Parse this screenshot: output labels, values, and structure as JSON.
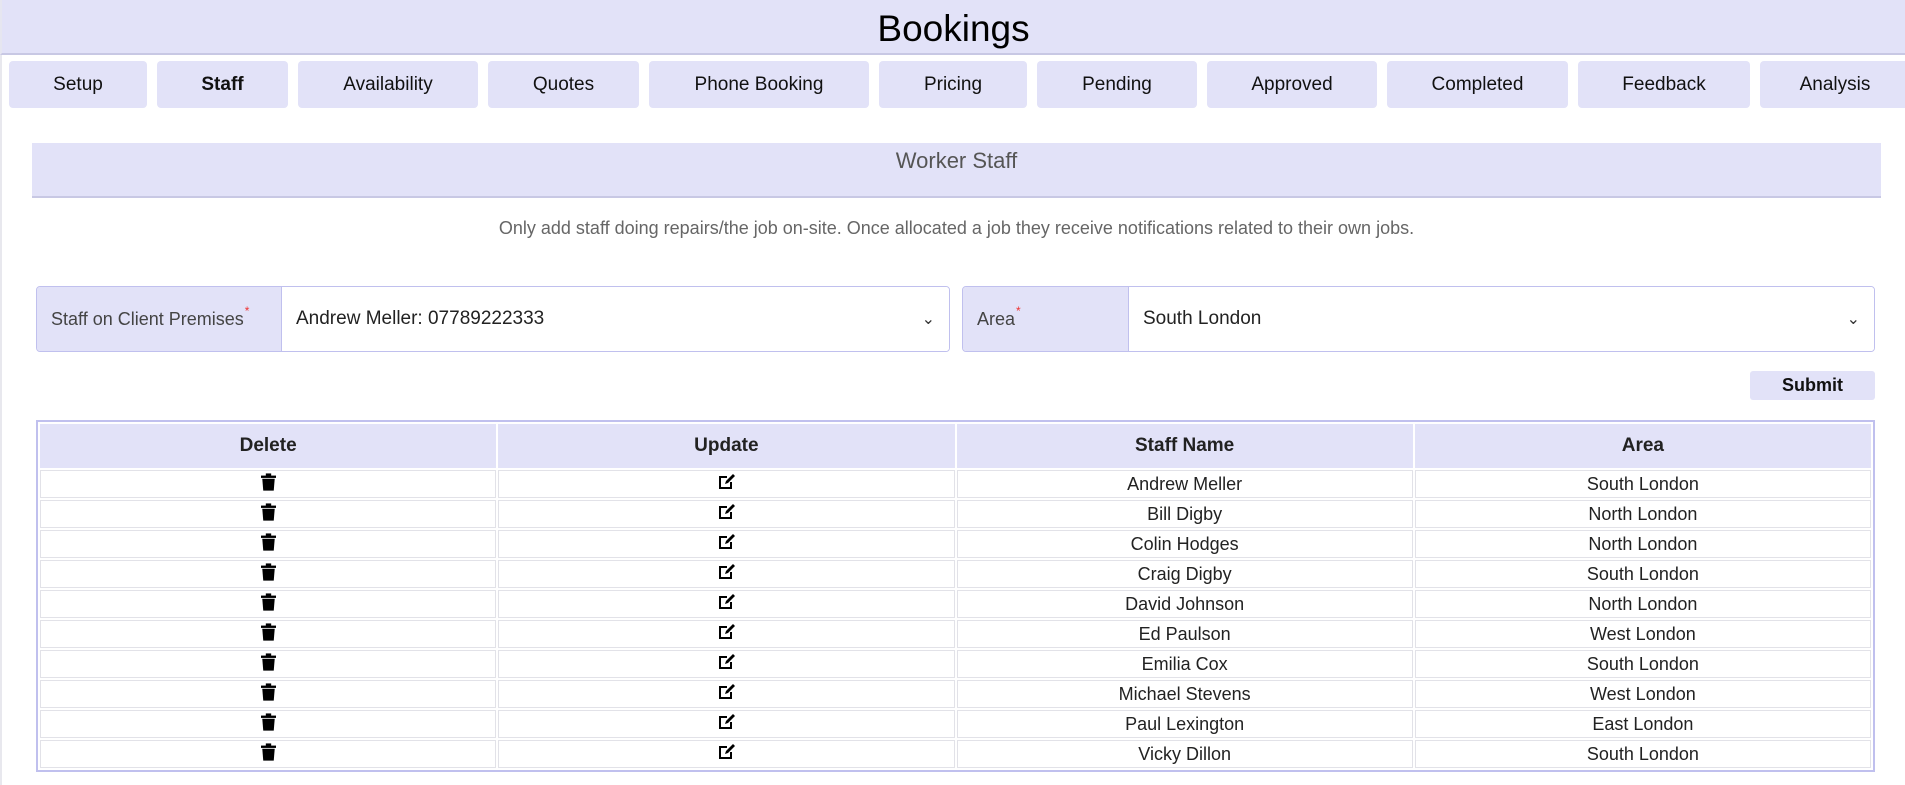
{
  "header": {
    "title": "Bookings"
  },
  "tabs": [
    {
      "label": "Setup",
      "active": false
    },
    {
      "label": "Staff",
      "active": true
    },
    {
      "label": "Availability",
      "active": false
    },
    {
      "label": "Quotes",
      "active": false
    },
    {
      "label": "Phone Booking",
      "active": false
    },
    {
      "label": "Pricing",
      "active": false
    },
    {
      "label": "Pending",
      "active": false
    },
    {
      "label": "Approved",
      "active": false
    },
    {
      "label": "Completed",
      "active": false
    },
    {
      "label": "Feedback",
      "active": false
    },
    {
      "label": "Analysis",
      "active": false
    }
  ],
  "section": {
    "title": "Worker Staff",
    "description": "Only add staff doing repairs/the job on-site. Once allocated a job they receive notifications related to their own jobs."
  },
  "form": {
    "staff_label": "Staff on Client Premises",
    "staff_value": "Andrew Meller: 07789222333",
    "area_label": "Area",
    "area_value": "South London",
    "required_mark": "*",
    "submit_label": "Submit"
  },
  "table": {
    "headers": [
      "Delete",
      "Update",
      "Staff Name",
      "Area"
    ],
    "rows": [
      {
        "name": "Andrew Meller",
        "area": "South London"
      },
      {
        "name": "Bill Digby",
        "area": "North London"
      },
      {
        "name": "Colin Hodges",
        "area": "North London"
      },
      {
        "name": "Craig Digby",
        "area": "South London"
      },
      {
        "name": "David Johnson",
        "area": "North London"
      },
      {
        "name": "Ed Paulson",
        "area": "West London"
      },
      {
        "name": "Emilia Cox",
        "area": "South London"
      },
      {
        "name": "Michael Stevens",
        "area": "West London"
      },
      {
        "name": "Paul Lexington",
        "area": "East London"
      },
      {
        "name": "Vicky Dillon",
        "area": "South London"
      }
    ]
  }
}
